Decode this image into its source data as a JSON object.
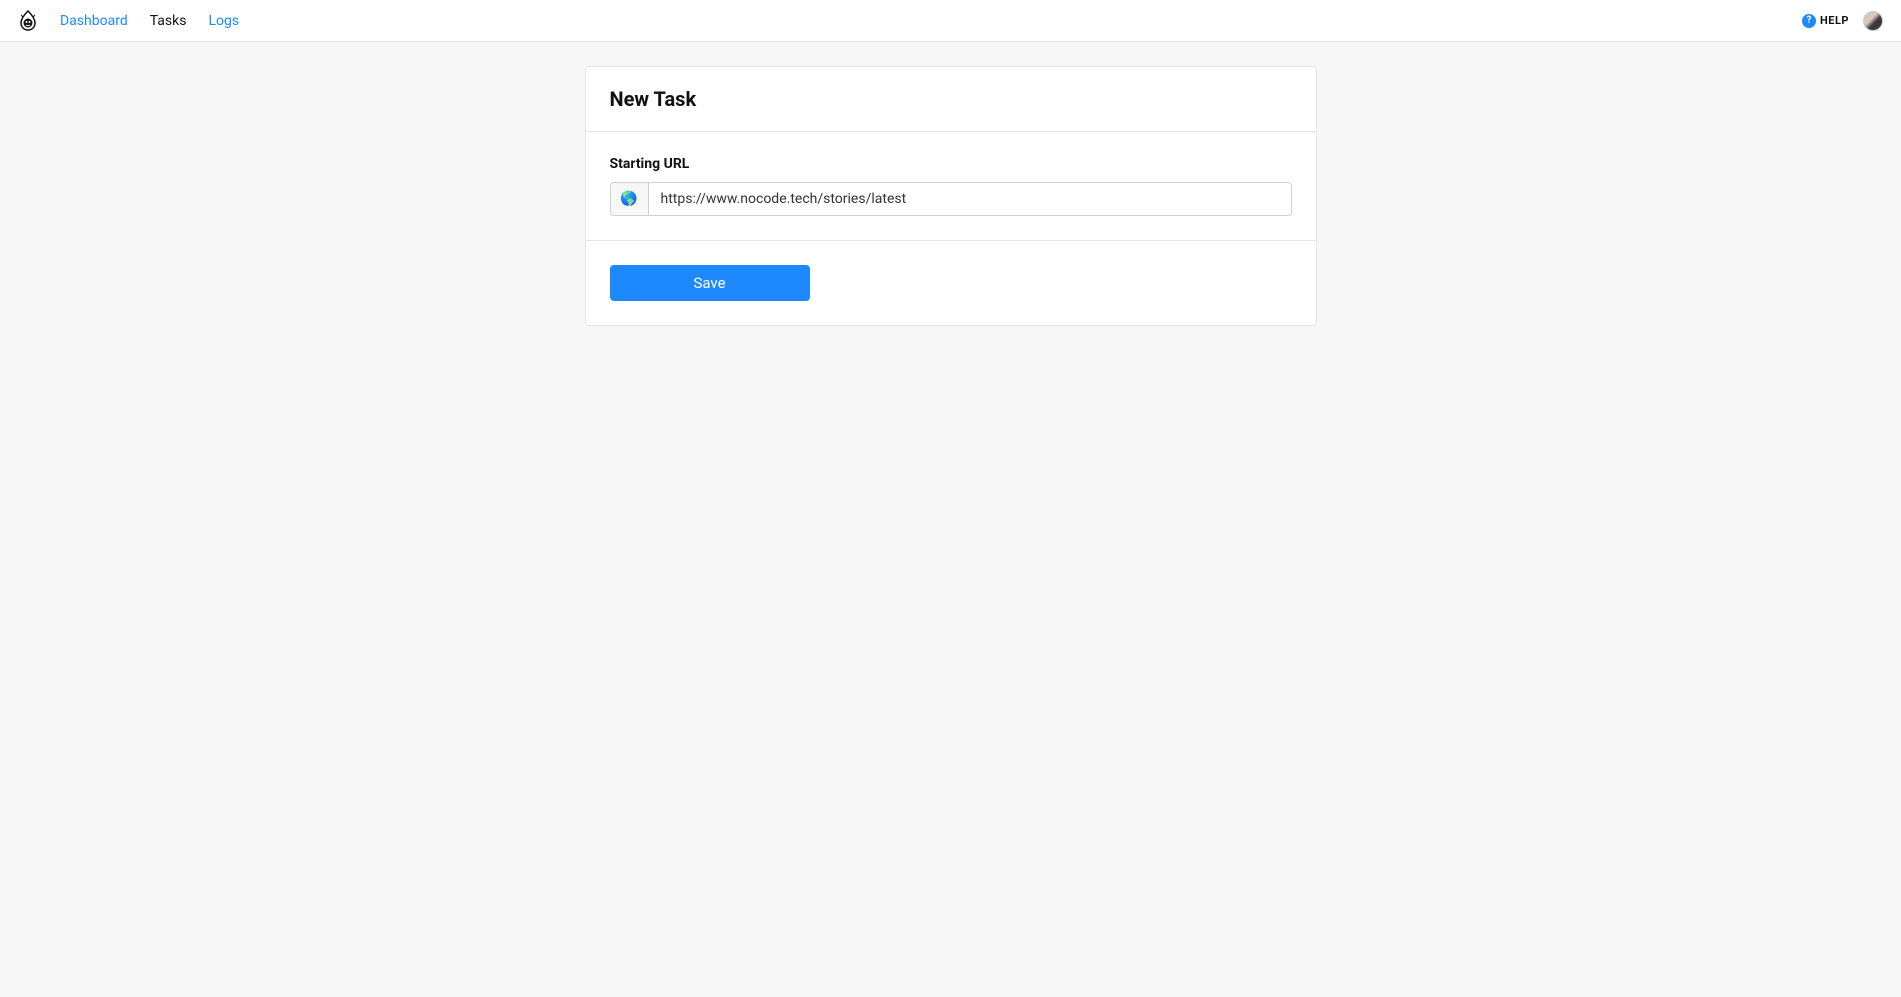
{
  "nav": {
    "dashboard": "Dashboard",
    "tasks": "Tasks",
    "logs": "Logs"
  },
  "header": {
    "help": "HELP"
  },
  "form": {
    "title": "New Task",
    "url_label": "Starting URL",
    "url_value": "https://www.nocode.tech/stories/latest",
    "save_label": "Save"
  }
}
